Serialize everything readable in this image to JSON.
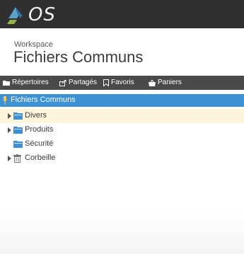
{
  "brand": {
    "logo_text": "OS"
  },
  "header": {
    "workspace_label": "Workspace",
    "title": "Fichiers Communs"
  },
  "tabs": [
    {
      "label": "Répertoires",
      "icon": "folder-icon"
    },
    {
      "label": "Partagés",
      "icon": "share-icon"
    },
    {
      "label": "Favoris",
      "icon": "bookmark-icon"
    },
    {
      "label": "Paniers",
      "icon": "basket-icon"
    }
  ],
  "tree": {
    "root": {
      "label": "Fichiers Communs",
      "icon": "pin-icon"
    },
    "items": [
      {
        "label": "Divers",
        "icon": "folder-icon",
        "expandable": true,
        "selected": true
      },
      {
        "label": "Produits",
        "icon": "folder-icon",
        "expandable": true,
        "selected": false
      },
      {
        "label": "Sécurité",
        "icon": "folder-icon",
        "expandable": false,
        "selected": false
      },
      {
        "label": "Corbeille",
        "icon": "trash-icon",
        "expandable": true,
        "selected": false
      }
    ]
  },
  "colors": {
    "topbar": "#2f2f2f",
    "tabbar": "#4a4a4a",
    "root_highlight": "#3d92d4",
    "selected_row": "#fdf6dd",
    "folder_blue": "#3a8fd6"
  }
}
